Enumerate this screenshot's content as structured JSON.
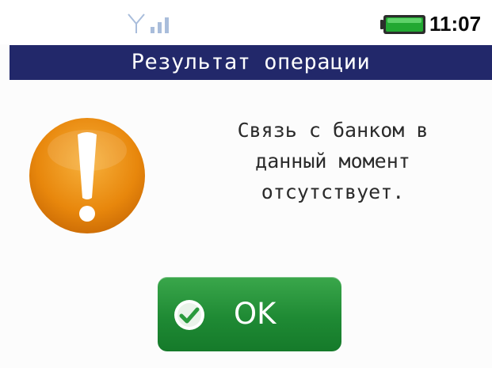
{
  "status_bar": {
    "time": "11:07",
    "signal_icon": "signal-icon",
    "battery_icon": "battery-icon",
    "battery_color": "#22a832"
  },
  "dialog": {
    "title": "Результат операции",
    "title_bar_color": "#22286a",
    "warning_icon": "exclamation-icon",
    "warning_color": "#e8870c",
    "message_lines": [
      "Связь с банком в",
      "данный момент",
      "отсутствует."
    ]
  },
  "ok_button": {
    "label": "OK",
    "icon": "check-circle-icon",
    "color": "#1f8a34"
  }
}
